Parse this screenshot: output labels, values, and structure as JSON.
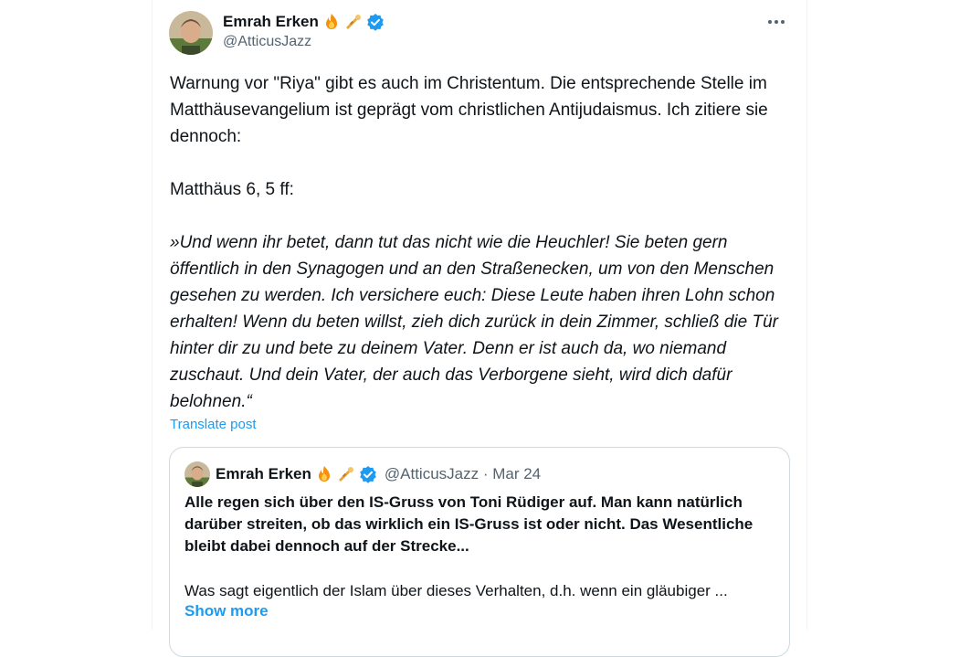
{
  "post": {
    "author_name": "Emrah Erken",
    "author_handle": "@AtticusJazz",
    "paragraphs": [
      "Warnung vor \"Riya\" gibt es auch im Christentum. Die entsprechende Stelle im Matthäusevangelium ist geprägt vom christlichen Antijudaismus. Ich zitiere sie dennoch:",
      "Matthäus 6, 5 ff:"
    ],
    "quote": "»Und wenn ihr betet, dann tut das nicht wie die Heuchler! Sie beten gern öffentlich in den Synagogen und an den Straßenecken, um von den Menschen gesehen zu werden. Ich versichere euch: Diese Leute haben ihren Lohn schon erhalten! Wenn du beten willst, zieh dich zurück in dein Zimmer, schließ die Tür hinter dir zu und bete zu deinem Vater. Denn er ist auch da, wo niemand zuschaut. Und dein Vater, der auch das Verborgene sieht, wird dich dafür belohnen.“",
    "translate_label": "Translate post"
  },
  "quoted_post": {
    "author_name": "Emrah Erken",
    "author_handle": "@AtticusJazz · Mar 24",
    "bold_text": "Alle regen sich über den IS-Gruss von Toni Rüdiger auf. Man kann natürlich darüber streiten, ob das wirklich ein IS-Gruss ist oder nicht. Das Wesentliche bleibt dabei dennoch auf der Strecke...",
    "text": "Was sagt eigentlich der Islam über dieses Verhalten, d.h. wenn ein gläubiger ...",
    "show_more_label": "Show more"
  },
  "icons": {
    "emoji_1": "fire-emoji-icon",
    "emoji_2": "trumpet-emoji-icon",
    "verified": "verified-badge-icon",
    "more": "more-options-icon"
  },
  "colors": {
    "accent": "#1d9bf0",
    "secondary_text": "#536471",
    "border": "#cfd9de"
  }
}
